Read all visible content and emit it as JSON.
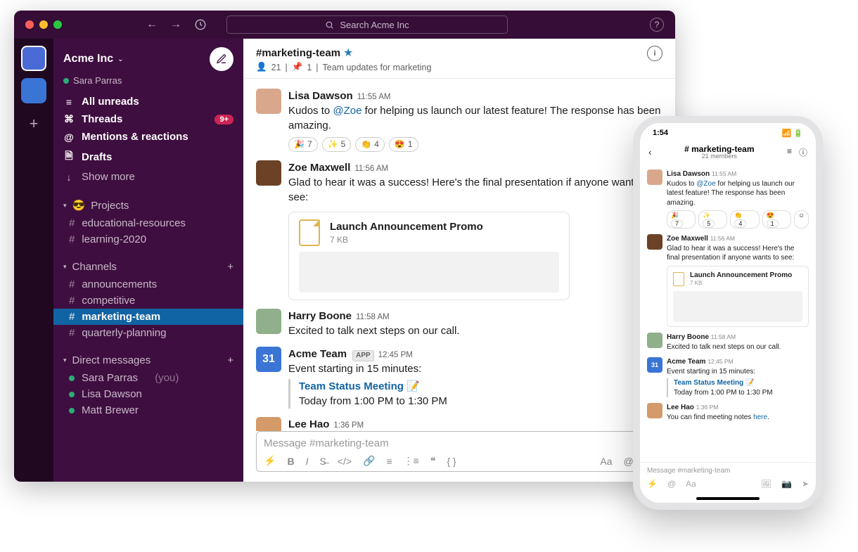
{
  "search_placeholder": "Search Acme Inc",
  "workspace": {
    "name": "Acme Inc",
    "user": "Sara Parras"
  },
  "nav": {
    "unreads": "All unreads",
    "threads": "Threads",
    "threads_badge": "9+",
    "mentions": "Mentions & reactions",
    "drafts": "Drafts",
    "more": "Show more"
  },
  "sections": {
    "projects": {
      "label": "Projects",
      "emoji": "😎",
      "items": [
        "educational-resources",
        "learning-2020"
      ]
    },
    "channels": {
      "label": "Channels",
      "items": [
        "announcements",
        "competitive",
        "marketing-team",
        "quarterly-planning"
      ],
      "active": "marketing-team"
    },
    "dms": {
      "label": "Direct messages",
      "items": [
        {
          "name": "Sara Parras",
          "you": "(you)"
        },
        {
          "name": "Lisa Dawson"
        },
        {
          "name": "Matt Brewer"
        }
      ]
    }
  },
  "channel_header": {
    "name": "#marketing-team",
    "members": "21",
    "pins": "1",
    "topic": "Team updates for marketing"
  },
  "messages": [
    {
      "author": "Lisa Dawson",
      "time": "11:55 AM",
      "avatar": "#d9a88c",
      "text_pre": "Kudos to ",
      "mention": "@Zoe",
      "text_post": " for helping us launch our latest feature! The response has been amazing.",
      "reactions": [
        {
          "e": "🎉",
          "c": "7"
        },
        {
          "e": "✨",
          "c": "5"
        },
        {
          "e": "👏",
          "c": "4"
        },
        {
          "e": "😍",
          "c": "1"
        }
      ]
    },
    {
      "author": "Zoe Maxwell",
      "time": "11:56 AM",
      "avatar": "#6b4226",
      "text": "Glad to hear it was a success! Here's the final presentation if anyone wants to see:",
      "attachment": {
        "name": "Launch Announcement Promo",
        "size": "7 KB"
      }
    },
    {
      "author": "Harry Boone",
      "time": "11:58 AM",
      "avatar": "#8fb08a",
      "text": "Excited to talk next steps on our call."
    },
    {
      "author": "Acme Team",
      "app": "APP",
      "time": "12:45 PM",
      "calendar": "31",
      "text": "Event starting in 15 minutes:",
      "event": {
        "title": "Team Status Meeting",
        "emoji": "📝",
        "time": "Today from 1:00 PM to 1:30 PM"
      }
    },
    {
      "author": "Lee Hao",
      "time": "1:36 PM",
      "avatar": "#d49a6a",
      "text_pre": "You can find meeting notes ",
      "link": "here",
      "text_post": "."
    }
  ],
  "composer": {
    "placeholder": "Message #marketing-team"
  },
  "mobile": {
    "clock": "1:54",
    "channel": "# marketing-team",
    "members": "21 members",
    "composer": "Message #marketing-team"
  }
}
